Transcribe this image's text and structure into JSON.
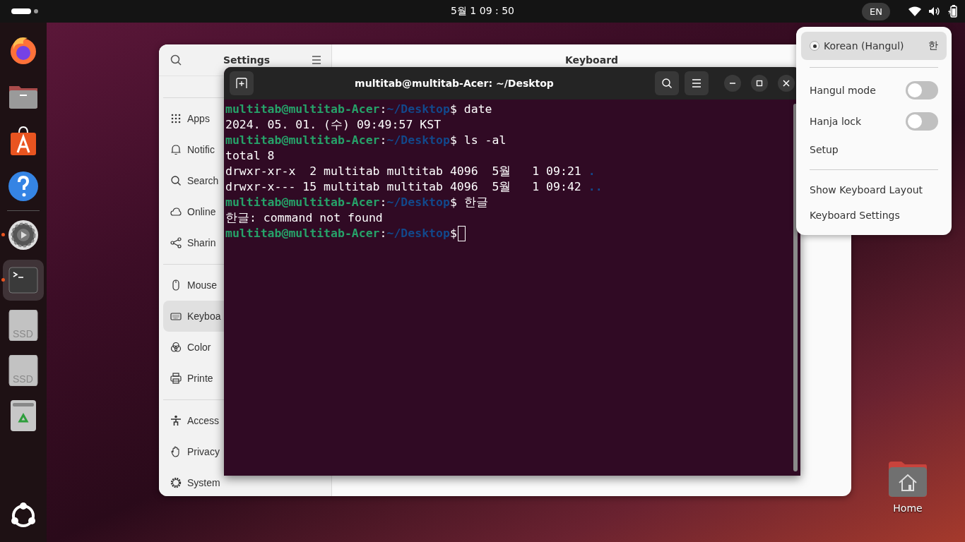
{
  "top_bar": {
    "clock": "5월 1  09 : 50",
    "input_indicator": "EN"
  },
  "dock": {
    "items": [
      {
        "kind": "browser",
        "running": false,
        "selected": false
      },
      {
        "kind": "files",
        "running": false,
        "selected": false
      },
      {
        "kind": "store",
        "running": false,
        "selected": false
      },
      {
        "kind": "help",
        "running": false,
        "selected": false
      },
      {
        "kind": "settings",
        "running": true,
        "selected": false
      },
      {
        "kind": "terminal",
        "running": true,
        "selected": true
      },
      {
        "kind": "drive",
        "label": "SSD",
        "running": false,
        "selected": false
      },
      {
        "kind": "drive",
        "label": "SSD",
        "running": false,
        "selected": false
      },
      {
        "kind": "trash",
        "running": false,
        "selected": false
      }
    ]
  },
  "settings_window": {
    "title": "Settings",
    "content_title": "Keyboard",
    "sidebar": {
      "groups": [
        [
          {
            "kind": "apps",
            "label": "Apps",
            "selected": false
          },
          {
            "kind": "bell",
            "label": "Notific",
            "selected": false
          },
          {
            "kind": "search",
            "label": "Search",
            "selected": false
          },
          {
            "kind": "cloud",
            "label": "Online",
            "selected": false
          },
          {
            "kind": "share",
            "label": "Sharin",
            "selected": false
          }
        ],
        [
          {
            "kind": "mouse",
            "label": "Mouse",
            "selected": false
          },
          {
            "kind": "keyboard",
            "label": "Keyboa",
            "selected": true
          },
          {
            "kind": "color",
            "label": "Color",
            "selected": false
          },
          {
            "kind": "printer",
            "label": "Printe",
            "selected": false
          }
        ],
        [
          {
            "kind": "person",
            "label": "Access",
            "selected": false
          },
          {
            "kind": "hand",
            "label": "Privacy",
            "selected": false
          },
          {
            "kind": "gear",
            "label": "System",
            "selected": false
          }
        ]
      ]
    }
  },
  "terminal": {
    "title": "multitab@multitab-Acer: ~/Desktop",
    "lines": [
      {
        "kind": "prompt",
        "user": "multitab@multitab-Acer",
        "separator": ":",
        "path": "~/Desktop",
        "symbol": "$",
        "command": "date"
      },
      {
        "kind": "output",
        "text": "2024. 05. 01. (수) 09:49:57 KST"
      },
      {
        "kind": "prompt",
        "user": "multitab@multitab-Acer",
        "separator": ":",
        "path": "~/Desktop",
        "symbol": "$",
        "command": "ls -al"
      },
      {
        "kind": "output",
        "text": "total 8"
      },
      {
        "kind": "output",
        "text": "drwxr-xr-x  2 multitab multitab 4096  5월   1 09:21 ",
        "dir": "."
      },
      {
        "kind": "output",
        "text": "drwxr-x--- 15 multitab multitab 4096  5월   1 09:42 ",
        "dir": ".."
      },
      {
        "kind": "prompt",
        "user": "multitab@multitab-Acer",
        "separator": ":",
        "path": "~/Desktop",
        "symbol": "$",
        "command": "한글"
      },
      {
        "kind": "output",
        "text": "한글: command not found"
      },
      {
        "kind": "prompt",
        "user": "multitab@multitab-Acer",
        "separator": ":",
        "path": "~/Desktop",
        "symbol": "$",
        "cursor": true
      }
    ]
  },
  "input_menu": {
    "source": {
      "label": "Korean (Hangul)",
      "symbol": "한",
      "selected": true
    },
    "toggles": [
      {
        "label": "Hangul mode",
        "on": false
      },
      {
        "label": "Hanja lock",
        "on": false
      }
    ],
    "items": [
      "Setup"
    ],
    "items_bottom": [
      "Show Keyboard Layout",
      "Keyboard Settings"
    ]
  },
  "desktop_icons": [
    {
      "label": "Home"
    }
  ]
}
